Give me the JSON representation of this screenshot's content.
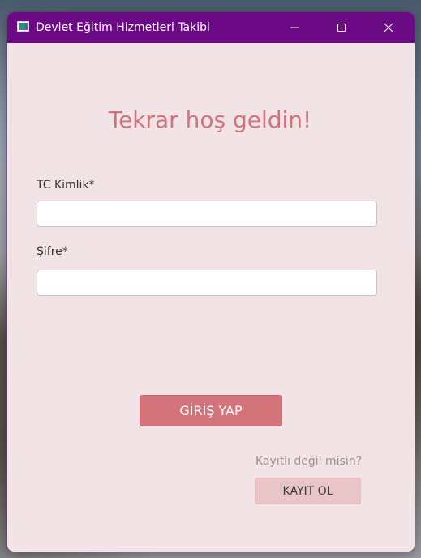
{
  "window": {
    "title": "Devlet Eğitim Hizmetleri Takibi",
    "controls": {
      "minimize_icon": "minimize-icon",
      "maximize_icon": "maximize-icon",
      "close_icon": "close-icon"
    }
  },
  "login": {
    "heading": "Tekrar hoş geldin!",
    "tc_label": "TC Kimlik*",
    "tc_value": "",
    "password_label": "Şifre*",
    "password_value": "",
    "login_button": "GİRİŞ YAP",
    "register_prompt": "Kayıtlı değil misin?",
    "register_button": "KAYIT OL"
  },
  "colors": {
    "titlebar": "#6b0a84",
    "window_background": "#f2e4e6",
    "accent": "#d3747a",
    "heading": "#d0737b",
    "secondary_button": "#eac5c8"
  }
}
